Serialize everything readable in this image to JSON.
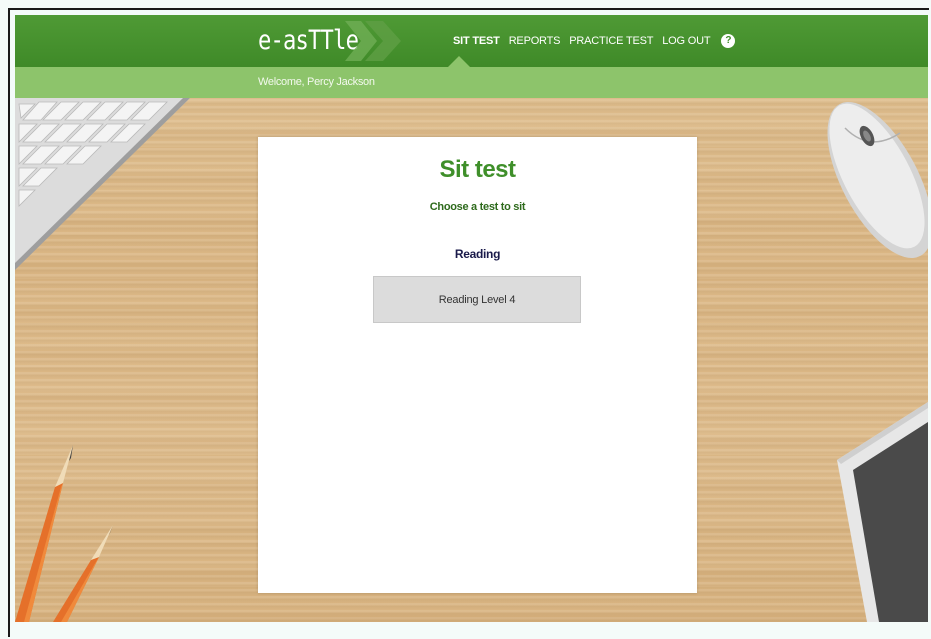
{
  "app": {
    "logo_text": "e-asTTle"
  },
  "nav": {
    "items": [
      {
        "label": "SIT TEST",
        "active": true
      },
      {
        "label": "REPORTS",
        "active": false
      },
      {
        "label": "PRACTICE TEST",
        "active": false
      },
      {
        "label": "LOG OUT",
        "active": false
      }
    ],
    "help_icon": "?"
  },
  "welcome": "Welcome, Percy Jackson",
  "main": {
    "title": "Sit test",
    "subtitle": "Choose a test to sit",
    "section_heading": "Reading",
    "tests": [
      {
        "label": "Reading Level 4"
      }
    ]
  },
  "colors": {
    "topbar": "#3f8a28",
    "subbar": "#8dc46b",
    "title": "#3f8f2a",
    "desk": "#dcb886"
  },
  "decorations": [
    "keyboard",
    "computer-mouse",
    "pencils",
    "tablet"
  ]
}
